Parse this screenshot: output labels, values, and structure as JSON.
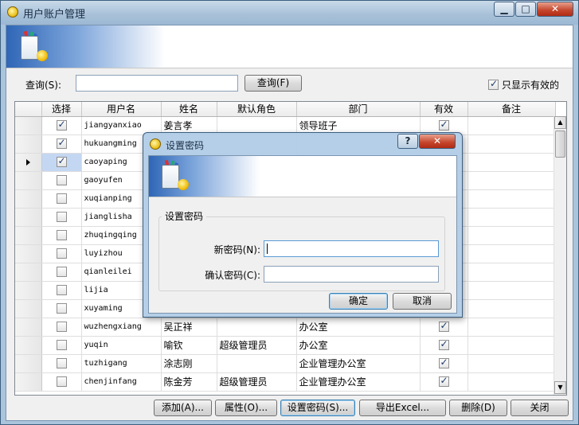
{
  "window": {
    "title": "用户账户管理",
    "min_glyph": "▁",
    "max_glyph": "□",
    "close_glyph": "✕"
  },
  "search": {
    "label": "查询(S):",
    "value": "",
    "button": "查询(F)"
  },
  "filter": {
    "only_valid_label": "只显示有效的",
    "checked": true
  },
  "table": {
    "columns": [
      "选择",
      "用户名",
      "姓名",
      "默认角色",
      "部门",
      "有效",
      "备注"
    ],
    "rows": [
      {
        "checked": true,
        "username": "jiangyanxiao",
        "name": "姜言孝",
        "role": "",
        "dept": "领导班子",
        "valid": true
      },
      {
        "checked": true,
        "username": "hukuangming",
        "name": "",
        "role": "",
        "dept": "",
        "valid": true
      },
      {
        "checked": true,
        "username": "caoyaping",
        "name": "",
        "role": "",
        "dept": "",
        "valid": true,
        "current": true
      },
      {
        "checked": false,
        "username": "gaoyufen",
        "name": "",
        "role": "",
        "dept": "",
        "valid": true
      },
      {
        "checked": false,
        "username": "xuqianping",
        "name": "",
        "role": "",
        "dept": "",
        "valid": true
      },
      {
        "checked": false,
        "username": "jianglisha",
        "name": "",
        "role": "",
        "dept": "",
        "valid": true
      },
      {
        "checked": false,
        "username": "zhuqingqing",
        "name": "",
        "role": "",
        "dept": "",
        "valid": true
      },
      {
        "checked": false,
        "username": "luyizhou",
        "name": "",
        "role": "",
        "dept": "",
        "valid": true
      },
      {
        "checked": false,
        "username": "qianleilei",
        "name": "",
        "role": "",
        "dept": "",
        "valid": true
      },
      {
        "checked": false,
        "username": "lijia",
        "name": "",
        "role": "",
        "dept": "",
        "valid": true
      },
      {
        "checked": false,
        "username": "xuyaming",
        "name": "",
        "role": "",
        "dept": "",
        "valid": true
      },
      {
        "checked": false,
        "username": "wuzhengxiang",
        "name": "吴正祥",
        "role": "",
        "dept": "办公室",
        "valid": true
      },
      {
        "checked": false,
        "username": "yuqin",
        "name": "喻钦",
        "role": "超级管理员",
        "dept": "办公室",
        "valid": true
      },
      {
        "checked": false,
        "username": "tuzhigang",
        "name": "涂志刚",
        "role": "",
        "dept": "企业管理办公室",
        "valid": true
      },
      {
        "checked": false,
        "username": "chenjinfang",
        "name": "陈金芳",
        "role": "超级管理员",
        "dept": "企业管理办公室",
        "valid": true
      }
    ]
  },
  "buttons": {
    "add": "添加(A)...",
    "props": "属性(O)...",
    "setpwd": "设置密码(S)...",
    "export": "导出Excel...",
    "delete": "删除(D)",
    "close": "关闭"
  },
  "dialog": {
    "title": "设置密码",
    "help_glyph": "?",
    "close_glyph": "✕",
    "group_label": "设置密码",
    "new_pwd_label": "新密码(N):",
    "confirm_pwd_label": "确认密码(C):",
    "new_pwd_value": "",
    "confirm_pwd_value": "",
    "ok": "确定",
    "cancel": "取消"
  }
}
